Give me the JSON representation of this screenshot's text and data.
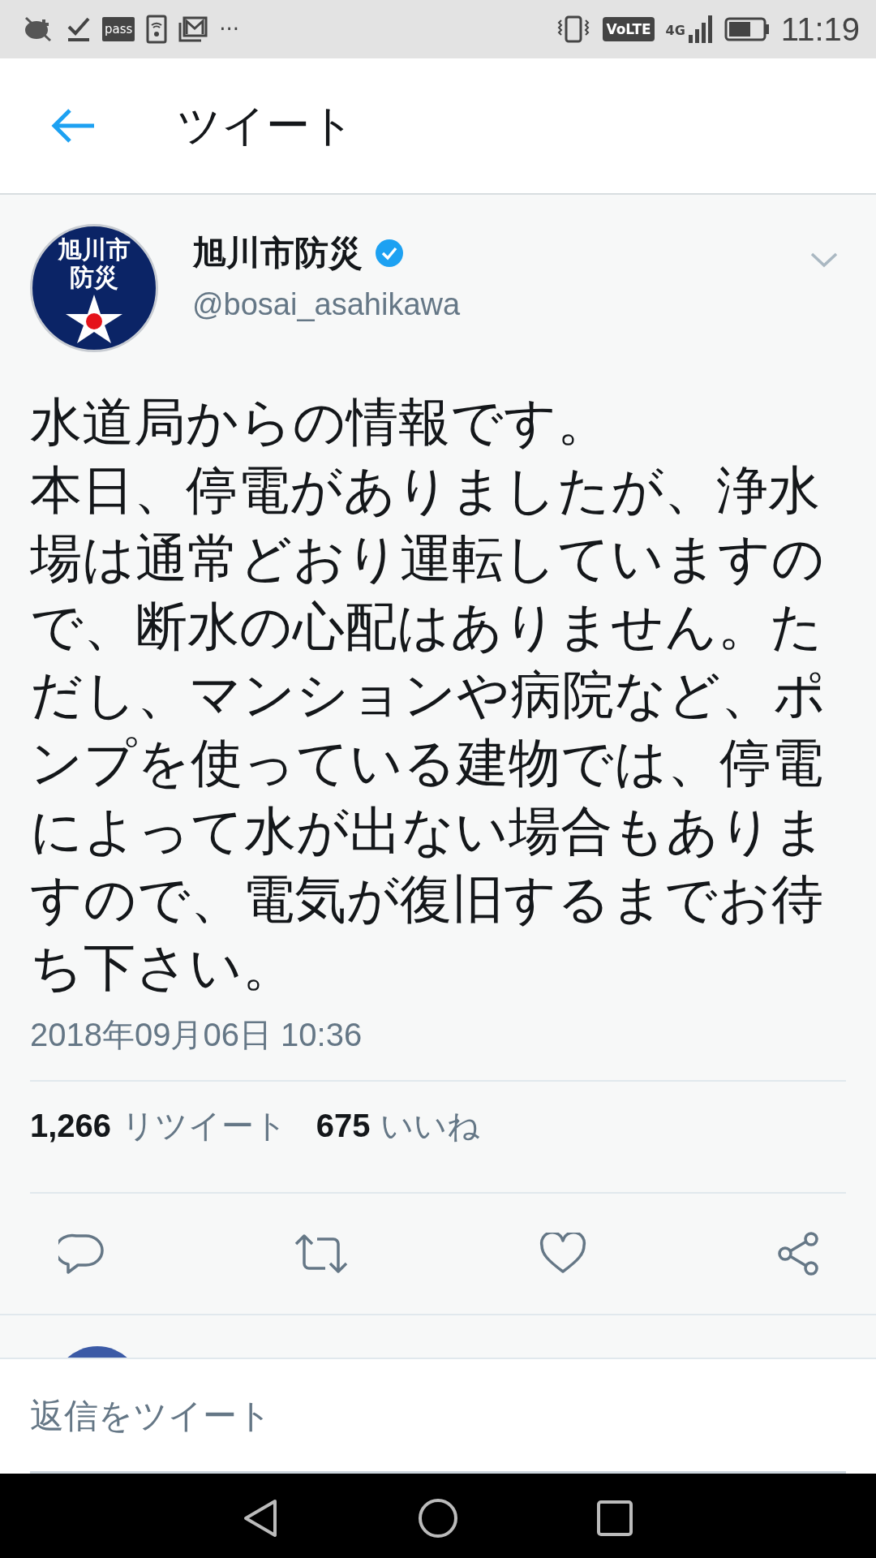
{
  "status_bar": {
    "pass_label": "pass",
    "more": "···",
    "volte": "VoLTE",
    "network": "4G",
    "time": "11:19"
  },
  "header": {
    "title": "ツイート"
  },
  "tweet": {
    "avatar_lines": [
      "旭川市",
      "防災"
    ],
    "name": "旭川市防災",
    "verified": true,
    "handle": "@bosai_asahikawa",
    "paragraphs": [
      "水道局からの情報です。",
      "本日、停電がありましたが、浄水場は通常どおり運転していますので、断水の心配はありません。ただし、マンションや病院など、ポンプを使っている建物では、停電によって水が出ない場合もありますので、電気が復旧するまでお待ち下さい。"
    ],
    "timestamp": "2018年09月06日 10:36",
    "stats": [
      {
        "count": "1,266",
        "label": "リツイート"
      },
      {
        "count": "675",
        "label": "いいね"
      }
    ]
  },
  "reply": {
    "placeholder": "返信をツイート"
  }
}
